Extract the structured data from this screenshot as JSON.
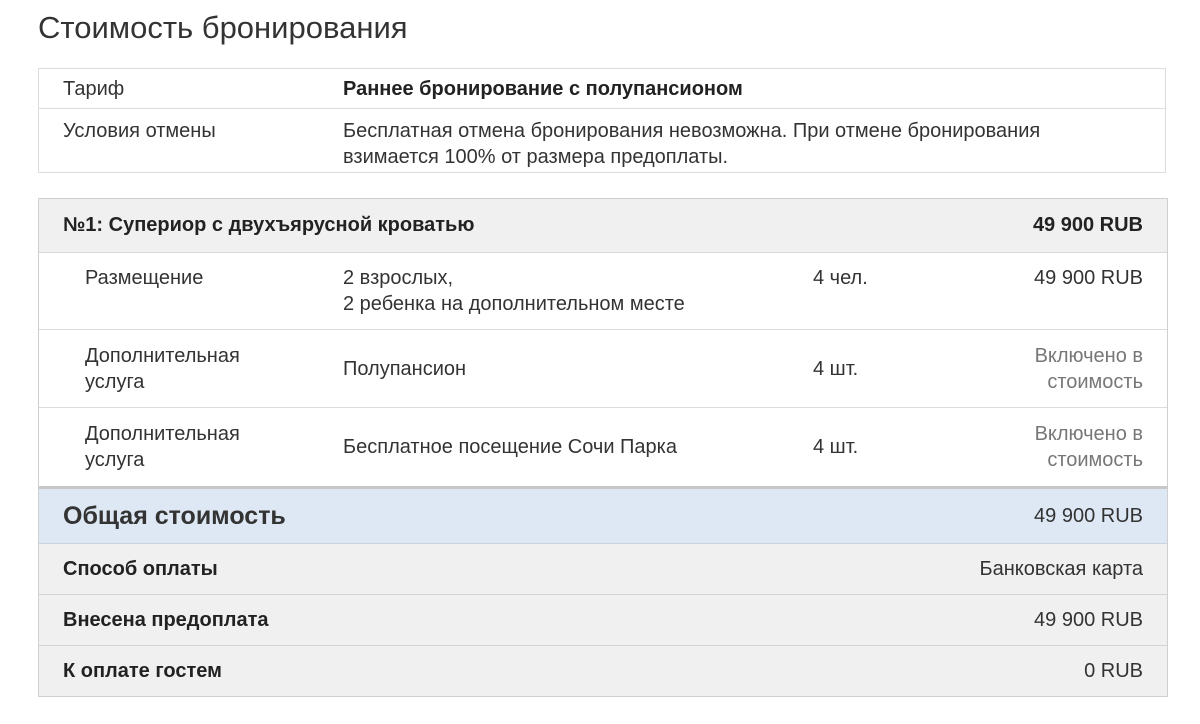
{
  "page": {
    "title": "Стоимость бронирования"
  },
  "tariff": {
    "rate_label": "Тариф",
    "rate_value": "Раннее бронирование с полупансионом",
    "cancel_label": "Условия отмены",
    "cancel_value_line1": "Бесплатная отмена бронирования невозможна. При отмене бронирования",
    "cancel_value_line2": "взимается 100% от размера предоплаты."
  },
  "room": {
    "name": "№1: Супериор с двухъярусной кроватью",
    "price": "49 900 RUB",
    "items": [
      {
        "type_line1": "Размещение",
        "type_line2": "",
        "desc_line1": "2 взрослых,",
        "desc_line2": "2 ребенка на дополнительном месте",
        "qty": "4 чел.",
        "price_line1": "49 900 RUB",
        "price_line2": ""
      },
      {
        "type_line1": "Дополнительная",
        "type_line2": "услуга",
        "desc_line1": "Полупансион",
        "desc_line2": "",
        "qty": "4 шт.",
        "price_line1": "Включено в",
        "price_line2": "стоимость"
      },
      {
        "type_line1": "Дополнительная",
        "type_line2": "услуга",
        "desc_line1": "Бесплатное посещение Сочи Парка",
        "desc_line2": "",
        "qty": "4 шт.",
        "price_line1": "Включено в",
        "price_line2": "стоимость"
      }
    ]
  },
  "totals": {
    "total_label": "Общая стоимость",
    "total_value": "49 900 RUB",
    "payment_method_label": "Способ оплаты",
    "payment_method_value": "Банковская карта",
    "prepaid_label": "Внесена предоплата",
    "prepaid_value": "49 900 RUB",
    "due_label": "К оплате гостем",
    "due_value": "0 RUB"
  },
  "colors": {
    "total_row_bg": "#dde8f4",
    "header_row_bg": "#f0f0f0",
    "muted_text": "#777777"
  }
}
